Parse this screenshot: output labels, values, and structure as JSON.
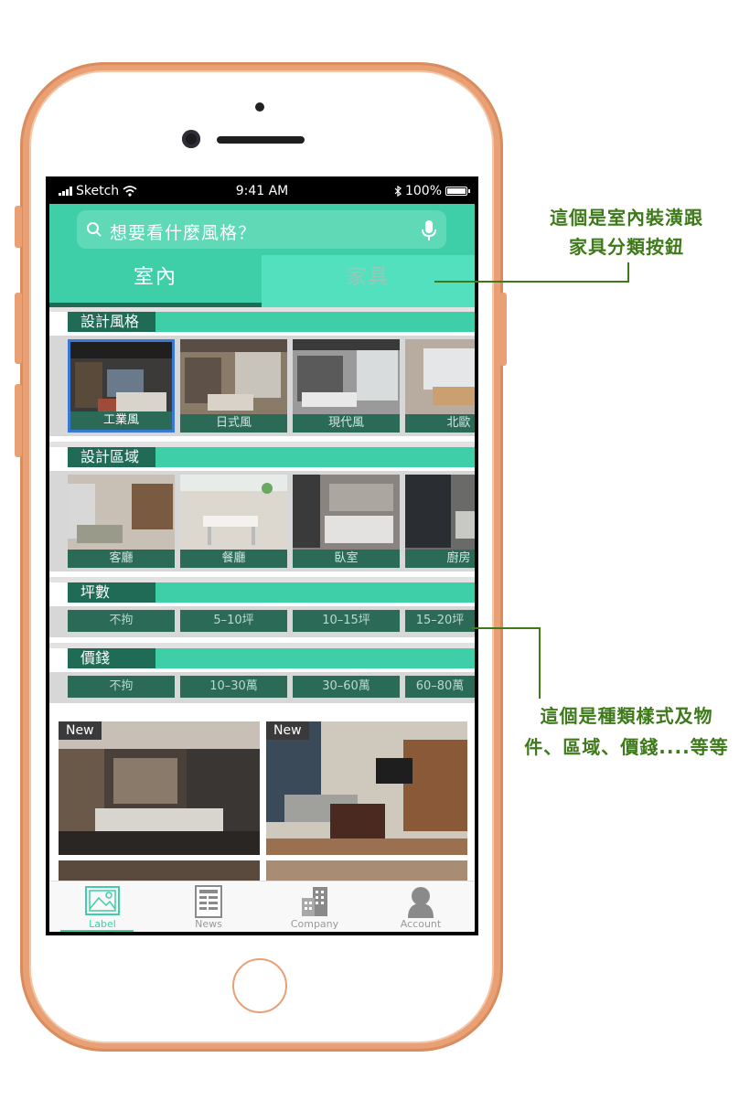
{
  "status_bar": {
    "carrier": "Sketch",
    "time": "9:41 AM",
    "battery": "100%"
  },
  "search": {
    "placeholder": "想要看什麼風格？"
  },
  "tabs": {
    "indoor": "室內",
    "furniture": "家具"
  },
  "sections": {
    "style": {
      "title": "設計風格",
      "items": [
        "工業風",
        "日式風",
        "現代風",
        "北歐"
      ]
    },
    "area": {
      "title": "設計區域",
      "items": [
        "客廳",
        "餐廳",
        "臥室",
        "廚房"
      ]
    },
    "size": {
      "title": "坪數",
      "items": [
        "不拘",
        "5–10坪",
        "10–15坪",
        "15–20坪"
      ]
    },
    "price": {
      "title": "價錢",
      "items": [
        "不拘",
        "10–30萬",
        "30–60萬",
        "60–80萬"
      ]
    }
  },
  "cards": {
    "badge": "New"
  },
  "tabbar": {
    "label": "Label",
    "news": "News",
    "company": "Company",
    "account": "Account"
  },
  "annotations": {
    "top": [
      "這個是室內裝潢跟",
      "家具分類按鈕"
    ],
    "bottom": [
      "這個是種類樣式及物",
      "件、區域、價錢....等等"
    ]
  },
  "colors": {
    "accent": "#3fcfa8",
    "dark_green": "#1f6b55",
    "annotation": "#3e7a1a",
    "frame": "#e9a074",
    "selected_border": "#3a78d6"
  }
}
